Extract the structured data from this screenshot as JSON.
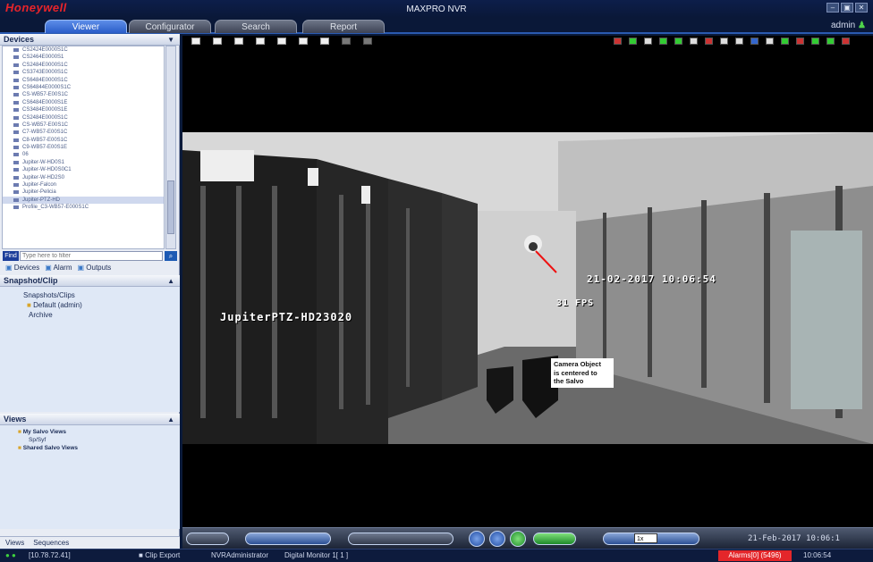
{
  "app": {
    "brand": "Honeywell",
    "title": "MAXPRO NVR",
    "window_buttons": [
      "–",
      "▣",
      "✕"
    ]
  },
  "tabs": [
    "Viewer",
    "Configurator",
    "Search",
    "Report"
  ],
  "active_tab": "Viewer",
  "user": {
    "name": "admin"
  },
  "panels": {
    "devices": {
      "title": "Devices",
      "items": [
        "CS2424E0000S1C",
        "CS2464E0000S1",
        "CS2484E0000S1C",
        "CS3743E0000S1C",
        "CS6484E0000S1C",
        "CS64844E0000S1C",
        "CS-WB57-E00S1C",
        "CS6484E0000S1E",
        "CS3484E0000S1E",
        "CS2484E0000S1C",
        "CS-WB57-E00S1C",
        "C7-WB57-E00S1C",
        "C8-WB57-E00S1C",
        "C9-WB57-E00S1E",
        "06",
        "Jupiter-W-HD0S1",
        "Jupiter-W-HD0S0C1",
        "Jupiter-W-HD2S0",
        "Jupiter-Falcon",
        "Jupiter-Pelicia",
        "Jupiter-PTZ-HD",
        "Profile_C3-WB57-E000S1C"
      ],
      "find_label": "Find",
      "find_placeholder": "Type here to filter",
      "tabs": [
        "Devices",
        "Alarm",
        "Outputs"
      ]
    },
    "snapshot": {
      "title": "Snapshot/Clip",
      "root": "Snapshots/Clips",
      "default_folder": "Default (admin)",
      "archive": "Archive"
    },
    "views": {
      "title": "Views",
      "my_salvo": "My Salvo Views",
      "child": "Sp/Syf",
      "shared_salvo": "Shared Salvo Views"
    },
    "bottom_tabs": [
      "Views",
      "Sequences"
    ]
  },
  "video": {
    "camera_label": "JupiterPTZ-HD23020",
    "timestamp": "21-02-2017 10:06:54",
    "fps": "31 FPS",
    "callout": [
      "Camera Object",
      "is centered to",
      "the Salvo"
    ]
  },
  "controls": {
    "zoom": "1x",
    "datetime": "21-Feb-2017 10:06:1"
  },
  "status": {
    "ip": "[10.78.72.41]",
    "clip_export": "Clip Export",
    "user": "NVRAdministrator",
    "monitor": "Digital Monitor 1[ 1 ]",
    "alarms": "Alarms[0] (5496)",
    "time": "10:06:54"
  }
}
